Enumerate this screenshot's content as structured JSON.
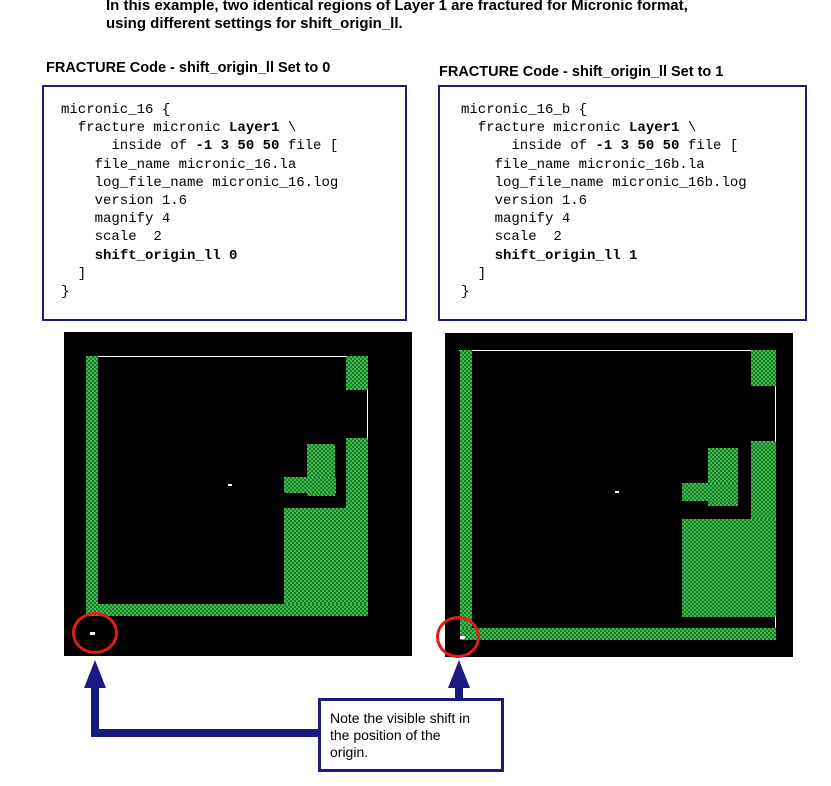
{
  "intro": {
    "line1": "In this example, two identical regions of Layer 1 are fractured for Micronic format,",
    "line2": "using different settings for shift_origin_ll."
  },
  "left": {
    "title": "FRACTURE Code - shift_origin_ll Set to 0",
    "code": {
      "l1": "micronic_16 {",
      "l2a": "  fracture micronic ",
      "l2b": "Layer1",
      "l2c": " \\",
      "l3a": "      inside of ",
      "l3b": "-1 3 50 50",
      "l3c": " file [",
      "l4": "    file_name micronic_16.la",
      "l5": "    log_file_name micronic_16.log",
      "l6": "    version 1.6",
      "l7": "    magnify 4",
      "l8": "    scale  2",
      "l9a": "    ",
      "l9b": "shift_origin_ll 0",
      "l10": "  ]",
      "l11": "}"
    }
  },
  "right": {
    "title": "FRACTURE Code - shift_origin_ll Set to 1",
    "code": {
      "l1": "micronic_16_b {",
      "l2a": "  fracture micronic ",
      "l2b": "Layer1",
      "l2c": " \\",
      "l3a": "      inside of ",
      "l3b": "-1 3 50 50",
      "l3c": " file [",
      "l4": "    file_name micronic_16b.la",
      "l5": "    log_file_name micronic_16b.log",
      "l6": "    version 1.6",
      "l7": "    magnify 4",
      "l8": "    scale  2",
      "l9a": "    ",
      "l9b": "shift_origin_ll 1",
      "l10": "  ]",
      "l11": "}"
    }
  },
  "note": {
    "line1": "Note the visible shift in",
    "line2": "the position of the",
    "line3": "origin."
  },
  "colors": {
    "box_border": "#1a1a80",
    "layer_fill": "#39c04a",
    "highlight_circle": "#e21b1b",
    "panel_bg": "#000000"
  }
}
